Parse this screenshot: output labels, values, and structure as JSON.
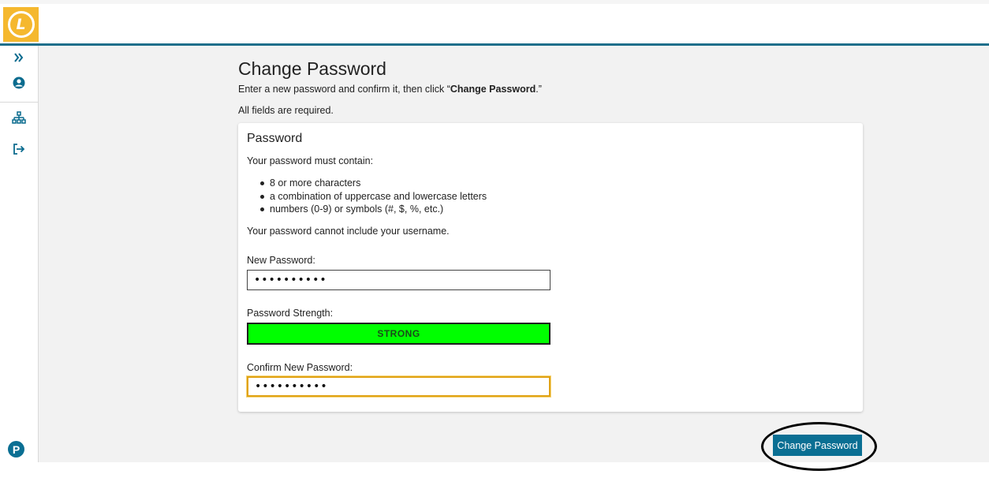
{
  "header": {
    "logo_letter": "L"
  },
  "sidebar": {
    "items": [
      {
        "name": "expand",
        "icon": "double-chevron-right-icon"
      },
      {
        "name": "profile",
        "icon": "user-circle-icon"
      },
      {
        "name": "sitemap",
        "icon": "sitemap-icon"
      },
      {
        "name": "logout",
        "icon": "sign-out-icon"
      }
    ],
    "footer_logo_letter": "P"
  },
  "page": {
    "title": "Change Password",
    "intro_prefix": "Enter a new password and confirm it, then click “",
    "intro_bold": "Change Password",
    "intro_suffix": ".”",
    "required_note": "All fields are required."
  },
  "card": {
    "title": "Password",
    "must_contain": "Your password must contain:",
    "rules": [
      "8 or more characters",
      "a combination of uppercase and lowercase letters",
      "numbers (0-9) or symbols (#, $, %, etc.)"
    ],
    "cannot_include": "Your password cannot include your username.",
    "new_password_label": "New Password:",
    "new_password_value": "••••••••••",
    "strength_label": "Password Strength:",
    "strength_value": "STRONG",
    "confirm_label": "Confirm New Password:",
    "confirm_value": "••••••••••"
  },
  "actions": {
    "change_password_label": "Change Password"
  },
  "colors": {
    "accent": "#0a6f93",
    "logo_bg": "#f5b82e",
    "strength_strong": "#00ff00",
    "focus_border": "#e0a213"
  }
}
